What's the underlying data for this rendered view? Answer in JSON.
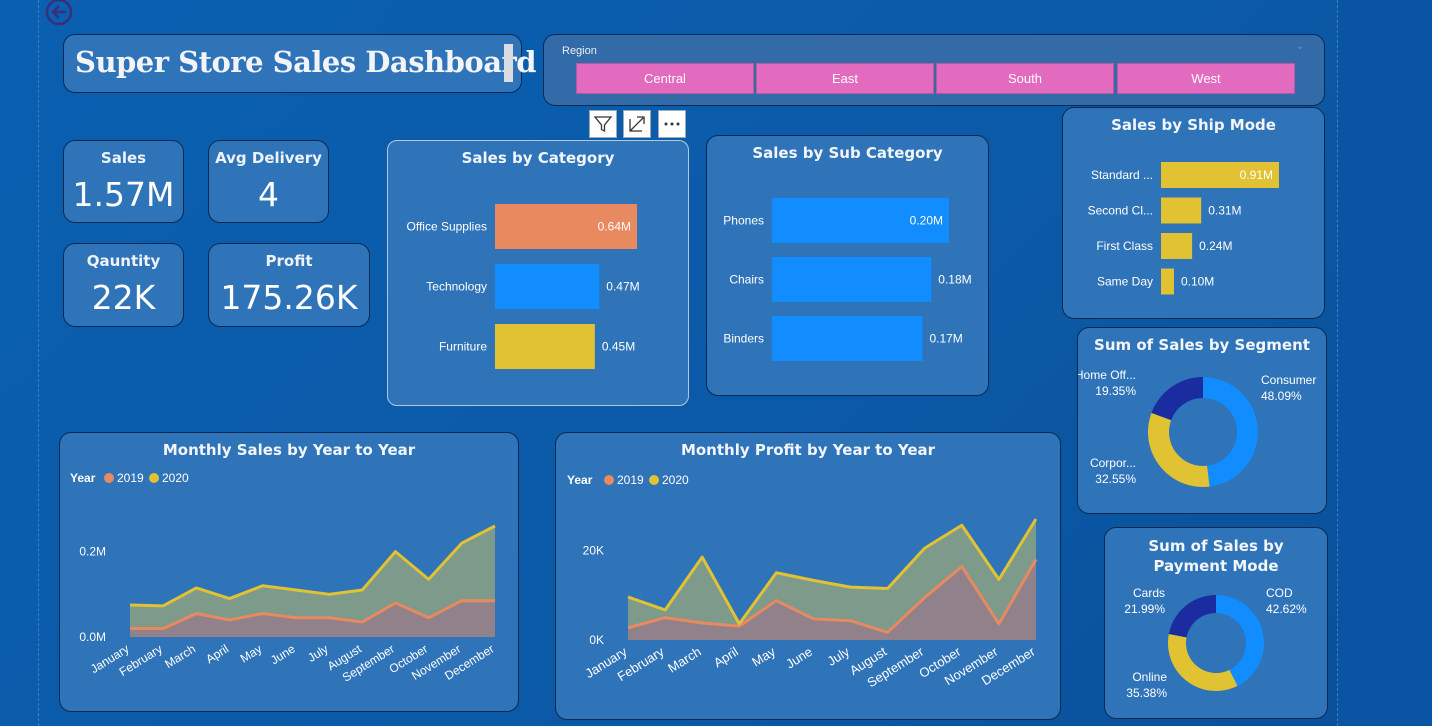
{
  "dashboard_title": "Super Store Sales Dashboard",
  "region_slicer": {
    "label": "Region",
    "options": [
      "Central",
      "East",
      "South",
      "West"
    ],
    "button_color": "#e36bbf"
  },
  "kpis": {
    "sales": {
      "label": "Sales",
      "value": "1.57M"
    },
    "avg_delivery": {
      "label": "Avg Delivery",
      "value": "4"
    },
    "quantity": {
      "label": "Qauntity",
      "value": "22K"
    },
    "profit": {
      "label": "Profit",
      "value": "175.26K"
    }
  },
  "icons": [
    "back-arrow-icon",
    "filter-icon",
    "focus-mode-icon",
    "more-options-icon"
  ],
  "colors": {
    "accent_blue": "#118dff",
    "accent_orange": "#e8895f",
    "accent_yellow": "#e0c232",
    "donut_navy": "#1a2ca0",
    "card_bg": "#2f73b8"
  },
  "chart_data": [
    {
      "type": "bar",
      "orientation": "horizontal",
      "title": "Sales by Category",
      "categories": [
        "Office Supplies",
        "Technology",
        "Furniture"
      ],
      "values": [
        0.64,
        0.47,
        0.45
      ],
      "labels": [
        "0.64M",
        "0.47M",
        "0.45M"
      ],
      "unit": "M",
      "colors": [
        "#e8895f",
        "#118dff",
        "#e0c232"
      ]
    },
    {
      "type": "bar",
      "orientation": "horizontal",
      "title": "Sales by Sub Category",
      "categories": [
        "Phones",
        "Chairs",
        "Binders"
      ],
      "values": [
        0.2,
        0.18,
        0.17
      ],
      "labels": [
        "0.20M",
        "0.18M",
        "0.17M"
      ],
      "unit": "M",
      "colors": [
        "#118dff",
        "#118dff",
        "#118dff"
      ]
    },
    {
      "type": "bar",
      "orientation": "horizontal",
      "title": "Sales by Ship Mode",
      "categories": [
        "Standard ...",
        "Second Cl...",
        "First Class",
        "Same Day"
      ],
      "values": [
        0.91,
        0.31,
        0.24,
        0.1
      ],
      "labels": [
        "0.91M",
        "0.31M",
        "0.24M",
        "0.10M"
      ],
      "unit": "M",
      "colors": [
        "#e0c232",
        "#e0c232",
        "#e0c232",
        "#e0c232"
      ]
    },
    {
      "type": "pie",
      "donut": true,
      "title": "Sum of Sales by Segment",
      "categories": [
        "Consumer",
        "Corpor...",
        "Home Off..."
      ],
      "values": [
        48.09,
        32.55,
        19.35
      ],
      "labels": [
        "48.09%",
        "32.55%",
        "19.35%"
      ],
      "colors": [
        "#118dff",
        "#e0c232",
        "#1a2ca0"
      ]
    },
    {
      "type": "pie",
      "donut": true,
      "title": "Sum of Sales by Payment Mode",
      "categories": [
        "COD",
        "Online",
        "Cards"
      ],
      "values": [
        42.62,
        35.38,
        21.99
      ],
      "labels": [
        "42.62%",
        "35.38%",
        "21.99%"
      ],
      "colors": [
        "#118dff",
        "#e0c232",
        "#1a2ca0"
      ]
    },
    {
      "type": "area",
      "title": "Monthly Sales by Year to Year",
      "legend_title": "Year",
      "legend_position": "top-left",
      "x": [
        "January",
        "February",
        "March",
        "April",
        "May",
        "June",
        "July",
        "August",
        "September",
        "October",
        "November",
        "December"
      ],
      "series": [
        {
          "name": "2019",
          "color": "#e8895f",
          "values": [
            0.02,
            0.02,
            0.055,
            0.04,
            0.055,
            0.045,
            0.045,
            0.035,
            0.08,
            0.045,
            0.085,
            0.085
          ]
        },
        {
          "name": "2020",
          "color": "#e0c232",
          "values": [
            0.075,
            0.073,
            0.115,
            0.09,
            0.12,
            0.11,
            0.1,
            0.11,
            0.2,
            0.135,
            0.22,
            0.26
          ]
        }
      ],
      "y_ticks": [
        "0.0M",
        "0.2M"
      ],
      "ylim": [
        0,
        0.26
      ]
    },
    {
      "type": "area",
      "title": "Monthly Profit by Year to Year",
      "legend_title": "Year",
      "legend_position": "top-left",
      "x": [
        "January",
        "February",
        "March",
        "April",
        "May",
        "June",
        "July",
        "August",
        "September",
        "October",
        "November",
        "December"
      ],
      "series": [
        {
          "name": "2019",
          "color": "#e8895f",
          "values": [
            2700,
            5000,
            3800,
            3100,
            8800,
            4700,
            4300,
            1700,
            9500,
            16400,
            3600,
            18000
          ]
        },
        {
          "name": "2020",
          "color": "#e0c232",
          "values": [
            9600,
            6700,
            18500,
            3600,
            15000,
            13300,
            11800,
            11500,
            20500,
            25600,
            13500,
            27000
          ]
        }
      ],
      "y_ticks": [
        "0K",
        "20K"
      ],
      "ylim": [
        0,
        27000
      ]
    }
  ]
}
